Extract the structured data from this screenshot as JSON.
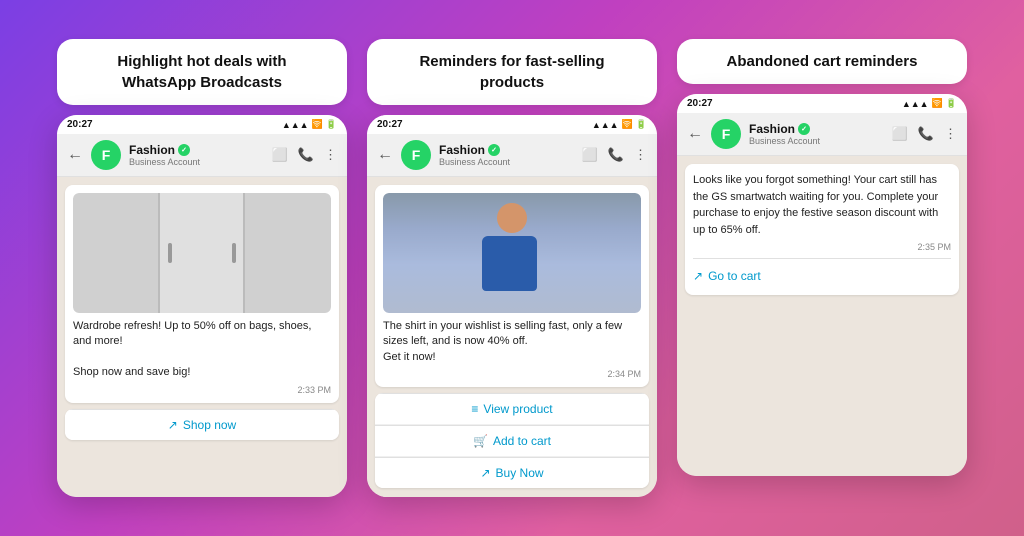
{
  "cards": [
    {
      "id": "broadcast",
      "title": "Highlight hot deals with\nWhatsApp Broadcasts",
      "status_time": "20:27",
      "contact_name": "Fashion",
      "contact_subtitle": "Business Account",
      "message_type": "image_text",
      "image_type": "wardrobe",
      "message_text": "Wardrobe refresh! Up to 50% off on bags, shoes, and more!\n\nShop now and save big!",
      "message_time": "2:33 PM",
      "actions": [
        {
          "icon": "🔗",
          "label": "Shop now"
        }
      ]
    },
    {
      "id": "reminders",
      "title": "Reminders for fast-selling\nproducts",
      "status_time": "20:27",
      "contact_name": "Fashion",
      "contact_subtitle": "Business Account",
      "message_type": "image_text",
      "image_type": "shirt",
      "message_text": "The shirt in your wishlist is selling fast, only a few sizes left, and is now 40% off.\nGet it now!",
      "message_time": "2:34 PM",
      "actions": [
        {
          "icon": "≡",
          "label": "View product"
        },
        {
          "icon": "🛒",
          "label": "Add to cart"
        },
        {
          "icon": "🔗",
          "label": "Buy Now"
        }
      ]
    },
    {
      "id": "abandoned-cart",
      "title": "Abandoned cart reminders",
      "status_time": "20:27",
      "contact_name": "Fashion",
      "contact_subtitle": "Business Account",
      "message_type": "text_only",
      "message_text": "Looks like you forgot something! Your cart still has the GS smartwatch waiting for you. Complete your purchase to enjoy the festive season discount with up to 65% off.",
      "message_time": "2:35 PM",
      "actions": [
        {
          "icon": "🔗",
          "label": "Go to cart"
        }
      ]
    }
  ],
  "icons": {
    "back": "←",
    "verified": "✓",
    "video": "📹",
    "phone": "📞",
    "more": "⋮",
    "external_link": "↗",
    "list": "≡",
    "cart": "🛒"
  }
}
